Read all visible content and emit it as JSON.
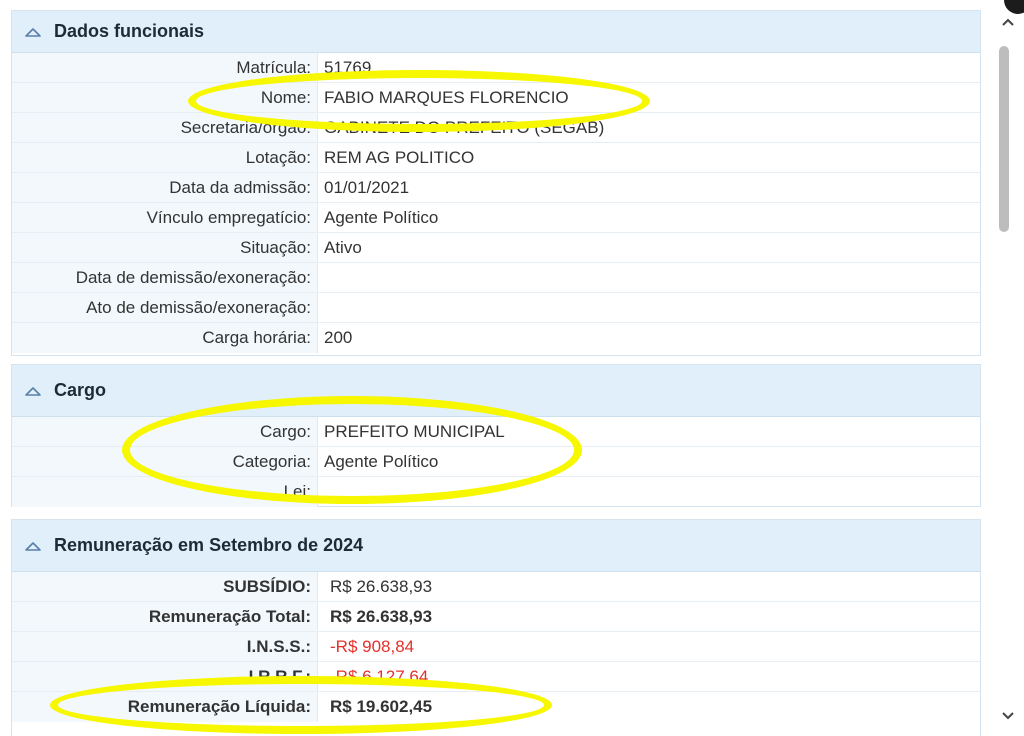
{
  "sections": {
    "dados": {
      "title": "Dados funcionais",
      "rows": [
        {
          "label": "Matrícula:",
          "value": "51769"
        },
        {
          "label": "Nome:",
          "value": "FABIO MARQUES FLORENCIO"
        },
        {
          "label": "Secretaria/orgão:",
          "value": "GABINETE DO PREFEITO (SEGAB)"
        },
        {
          "label": "Lotação:",
          "value": "REM AG POLITICO"
        },
        {
          "label": "Data da admissão:",
          "value": "01/01/2021"
        },
        {
          "label": "Vínculo empregatício:",
          "value": "Agente Político"
        },
        {
          "label": "Situação:",
          "value": "Ativo"
        },
        {
          "label": "Data de demissão/exoneração:",
          "value": ""
        },
        {
          "label": "Ato de demissão/exoneração:",
          "value": ""
        },
        {
          "label": "Carga horária:",
          "value": "200"
        }
      ]
    },
    "cargo": {
      "title": "Cargo",
      "rows": [
        {
          "label": "Cargo:",
          "value": "PREFEITO MUNICIPAL"
        },
        {
          "label": "Categoria:",
          "value": "Agente Político"
        },
        {
          "label": "Lei:",
          "value": ""
        }
      ]
    },
    "remuneracao": {
      "title": "Remuneração em Setembro de 2024",
      "rows": [
        {
          "label": "SUBSÍDIO:",
          "value": "R$ 26.638,93"
        },
        {
          "label": "Remuneração Total:",
          "value": "R$ 26.638,93"
        },
        {
          "label": "I.N.S.S.:",
          "value": "-R$ 908,84"
        },
        {
          "label": "I.R.R.F.:",
          "value": "-R$ 6.127,64"
        },
        {
          "label": "Remuneração Líquida:",
          "value": "R$ 19.602,45"
        }
      ]
    }
  },
  "colors": {
    "header_bg": "#e1effa",
    "label_bg": "#f2f8fc",
    "negative": "#e5302b",
    "highlight": "#f7f700"
  },
  "icons": {
    "section_toggle": "chevron-up-icon",
    "scroll_up": "scroll-up-arrow-icon",
    "scroll_down": "scroll-down-arrow-icon"
  }
}
